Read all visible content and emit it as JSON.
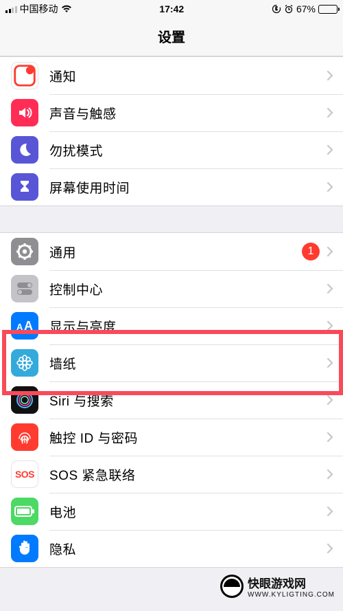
{
  "status": {
    "carrier": "中国移动",
    "time": "17:42",
    "battery": "67%"
  },
  "header": {
    "title": "设置"
  },
  "group1": [
    {
      "label": "通知"
    },
    {
      "label": "声音与触感"
    },
    {
      "label": "勿扰模式"
    },
    {
      "label": "屏幕使用时间"
    }
  ],
  "group2": [
    {
      "label": "通用",
      "badge": "1"
    },
    {
      "label": "控制中心"
    },
    {
      "label": "显示与亮度"
    },
    {
      "label": "墙纸"
    },
    {
      "label": "Siri 与搜索"
    },
    {
      "label": "触控 ID 与密码"
    },
    {
      "label": "SOS 紧急联络",
      "sos": "SOS"
    },
    {
      "label": "电池"
    },
    {
      "label": "隐私"
    }
  ],
  "watermark": {
    "line1": "快眼游戏网",
    "line2": "WWW.KYLIGTING.COM"
  }
}
